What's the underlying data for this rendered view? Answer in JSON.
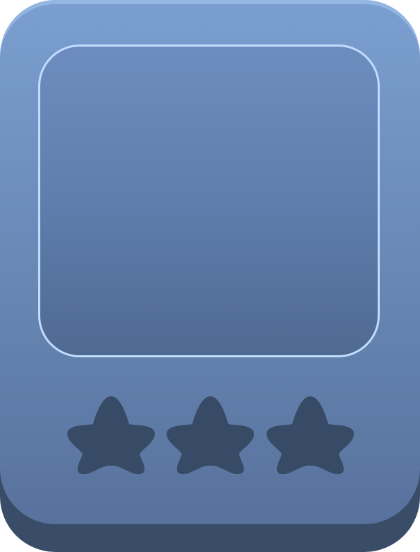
{
  "card": {
    "colors": {
      "face_top": "#7a9fd0",
      "face_bottom": "#57729c",
      "base": "#3a4d68",
      "window_border": "#c2dcff",
      "star_filled": "#374b66",
      "star_empty": "#6f8ab5"
    },
    "art_window": {
      "content": "empty"
    },
    "rating": {
      "value": 3,
      "max": 3,
      "stars": [
        {
          "icon": "star-icon",
          "filled": true
        },
        {
          "icon": "star-icon",
          "filled": true
        },
        {
          "icon": "star-icon",
          "filled": true
        }
      ]
    }
  }
}
